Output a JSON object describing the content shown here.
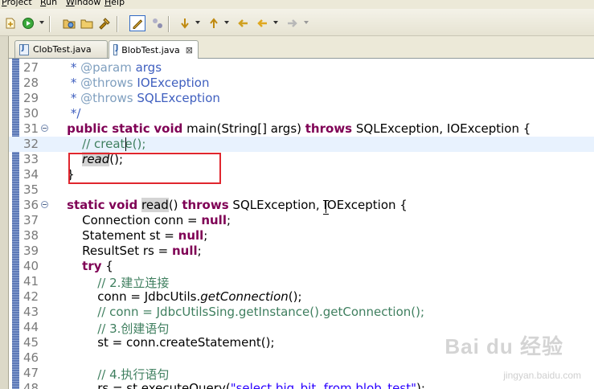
{
  "menubar": {
    "items": [
      {
        "label": "Project",
        "mnemonic": "P"
      },
      {
        "label": "Run",
        "mnemonic": "R"
      },
      {
        "label": "Window",
        "mnemonic": "W"
      },
      {
        "label": "Help",
        "mnemonic": "H"
      }
    ]
  },
  "toolbar": {
    "buttons": [
      "new-icon",
      "run-icon",
      "open-type-icon",
      "open-folder-icon",
      "build-icon",
      "toggle-mark-icon",
      "dependency-icon",
      "next-annotation-icon",
      "last-edit-icon",
      "back-icon",
      "forward-icon"
    ]
  },
  "tabs": [
    {
      "label": "ClobTest.java",
      "active": false
    },
    {
      "label": "BlobTest.java",
      "active": true,
      "close": "⊠"
    }
  ],
  "editor": {
    "current_line": 32,
    "lines": [
      {
        "n": "27",
        "code": "     * @param args"
      },
      {
        "n": "28",
        "code": "     * @throws IOException"
      },
      {
        "n": "29",
        "code": "     * @throws SQLException"
      },
      {
        "n": "30",
        "code": "     */"
      },
      {
        "n": "31",
        "code": "    public static void main(String[] args) throws SQLException, IOException {"
      },
      {
        "n": "32",
        "code": "        // create();"
      },
      {
        "n": "33",
        "code": "        read();"
      },
      {
        "n": "34",
        "code": "    }"
      },
      {
        "n": "35",
        "code": ""
      },
      {
        "n": "36",
        "code": "    static void read() throws SQLException, IOException {"
      },
      {
        "n": "37",
        "code": "        Connection conn = null;"
      },
      {
        "n": "38",
        "code": "        Statement st = null;"
      },
      {
        "n": "39",
        "code": "        ResultSet rs = null;"
      },
      {
        "n": "40",
        "code": "        try {"
      },
      {
        "n": "41",
        "code": "            // 2.建立连接"
      },
      {
        "n": "42",
        "code": "            conn = JdbcUtils.getConnection();"
      },
      {
        "n": "43",
        "code": "            // conn = JdbcUtilsSing.getInstance().getConnection();"
      },
      {
        "n": "44",
        "code": "            // 3.创建语句"
      },
      {
        "n": "45",
        "code": "            st = conn.createStatement();"
      },
      {
        "n": "46",
        "code": ""
      },
      {
        "n": "47",
        "code": "            // 4.执行语句"
      },
      {
        "n": "48",
        "code": "            rs = st.executeQuery(\"select big_bit  from blob_test\");"
      }
    ]
  },
  "watermark": {
    "brand": "Bai du 经验",
    "url": "jingyan.baidu.com"
  },
  "colors": {
    "keyword": "#7f0055",
    "javadoc": "#3f5fbf",
    "comment": "#3f7f5f",
    "string": "#2a00ff",
    "highlight_box": "#e0262e",
    "current_line": "#e8f2fe"
  }
}
